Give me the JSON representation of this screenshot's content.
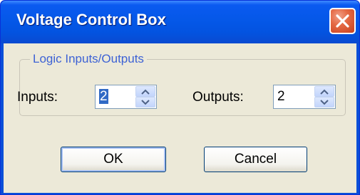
{
  "window": {
    "title": "Voltage Control Box",
    "close_icon": "close-x-icon"
  },
  "group": {
    "legend": "Logic Inputs/Outputs",
    "inputs_label": "Inputs:",
    "inputs_value": "2",
    "outputs_label": "Outputs:",
    "outputs_value": "2"
  },
  "buttons": {
    "ok_label": "OK",
    "cancel_label": "Cancel"
  },
  "colors": {
    "titlebar": "#0558e8",
    "dialog_background": "#ece9d8",
    "group_legend": "#3d62d5",
    "close_button": "#e56a45"
  }
}
